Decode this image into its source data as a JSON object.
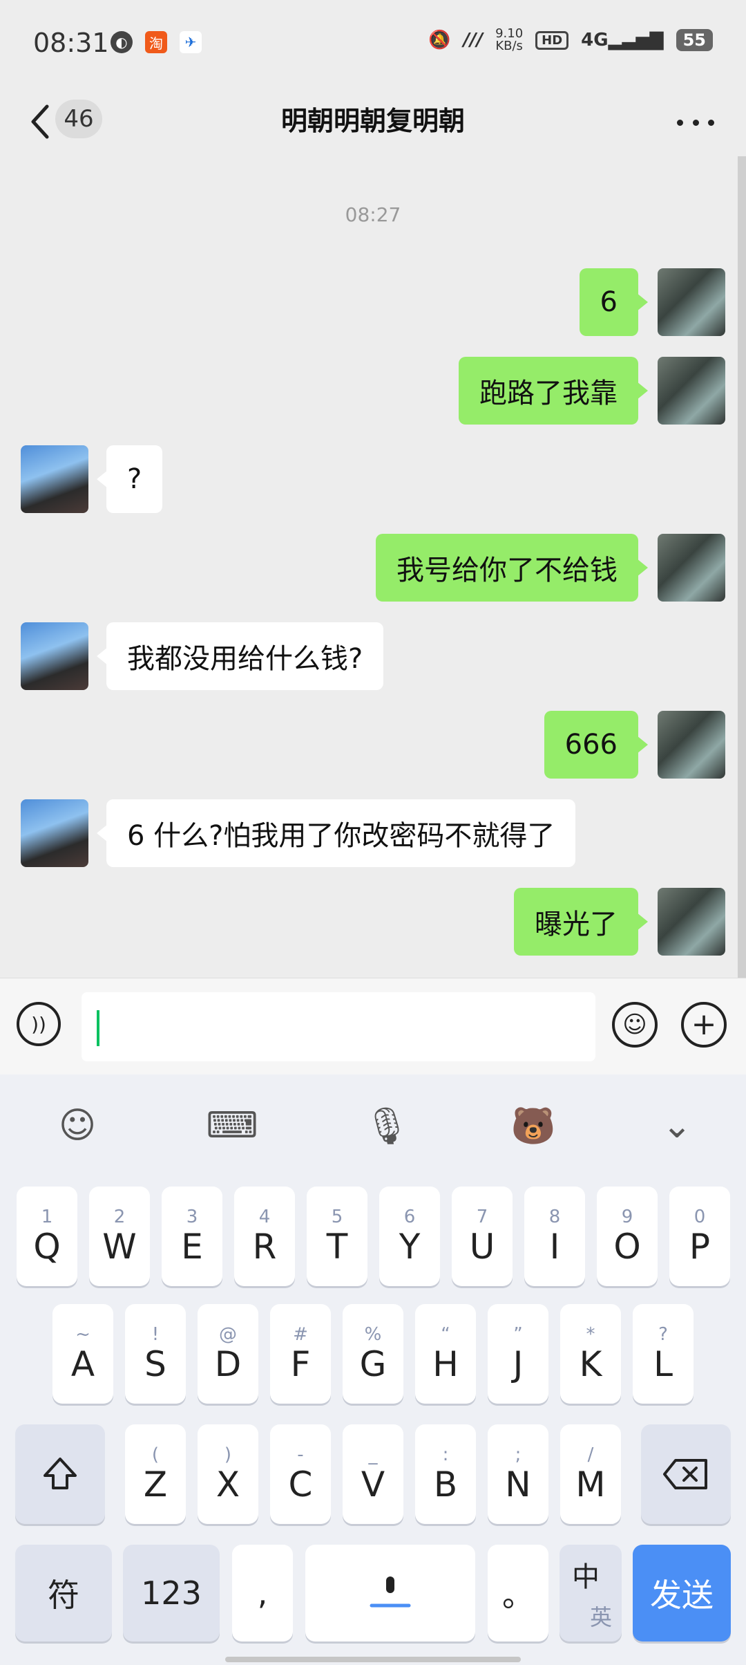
{
  "status_bar": {
    "time": "08:31",
    "left_icons": [
      "app-icon-1",
      "taobao-icon",
      "bird-app-icon"
    ],
    "network_speed_value": "9.10",
    "network_speed_unit": "KB/s",
    "hd": "HD",
    "signal": "4G",
    "battery": "55"
  },
  "header": {
    "back_count": "46",
    "title": "明朝明朝复明朝"
  },
  "chat": {
    "timestamp": "08:27",
    "messages": [
      {
        "from": "me",
        "text": "6"
      },
      {
        "from": "me",
        "text": "跑路了我靠"
      },
      {
        "from": "other",
        "text": "?"
      },
      {
        "from": "me",
        "text": "我号给你了不给钱"
      },
      {
        "from": "other",
        "text": "我都没用给什么钱?"
      },
      {
        "from": "me",
        "text": "666"
      },
      {
        "from": "other",
        "text": "6 什么?怕我用了你改密码不就得了"
      },
      {
        "from": "me",
        "text": "曝光了"
      }
    ]
  },
  "keyboard": {
    "row1": [
      {
        "main": "Q",
        "sub": "1"
      },
      {
        "main": "W",
        "sub": "2"
      },
      {
        "main": "E",
        "sub": "3"
      },
      {
        "main": "R",
        "sub": "4"
      },
      {
        "main": "T",
        "sub": "5"
      },
      {
        "main": "Y",
        "sub": "6"
      },
      {
        "main": "U",
        "sub": "7"
      },
      {
        "main": "I",
        "sub": "8"
      },
      {
        "main": "O",
        "sub": "9"
      },
      {
        "main": "P",
        "sub": "0"
      }
    ],
    "row2": [
      {
        "main": "A",
        "sub": "~"
      },
      {
        "main": "S",
        "sub": "!"
      },
      {
        "main": "D",
        "sub": "@"
      },
      {
        "main": "F",
        "sub": "#"
      },
      {
        "main": "G",
        "sub": "%"
      },
      {
        "main": "H",
        "sub": "“"
      },
      {
        "main": "J",
        "sub": "”"
      },
      {
        "main": "K",
        "sub": "*"
      },
      {
        "main": "L",
        "sub": "?"
      }
    ],
    "row3": [
      {
        "main": "Z",
        "sub": "("
      },
      {
        "main": "X",
        "sub": ")"
      },
      {
        "main": "C",
        "sub": "-"
      },
      {
        "main": "V",
        "sub": "_"
      },
      {
        "main": "B",
        "sub": ":"
      },
      {
        "main": "N",
        "sub": ";"
      },
      {
        "main": "M",
        "sub": "/"
      }
    ],
    "symbols_label": "符",
    "numbers_label": "123",
    "comma_label": ",",
    "period_label": "。",
    "zh_label": "中",
    "en_label": "英",
    "send_label": "发送"
  }
}
